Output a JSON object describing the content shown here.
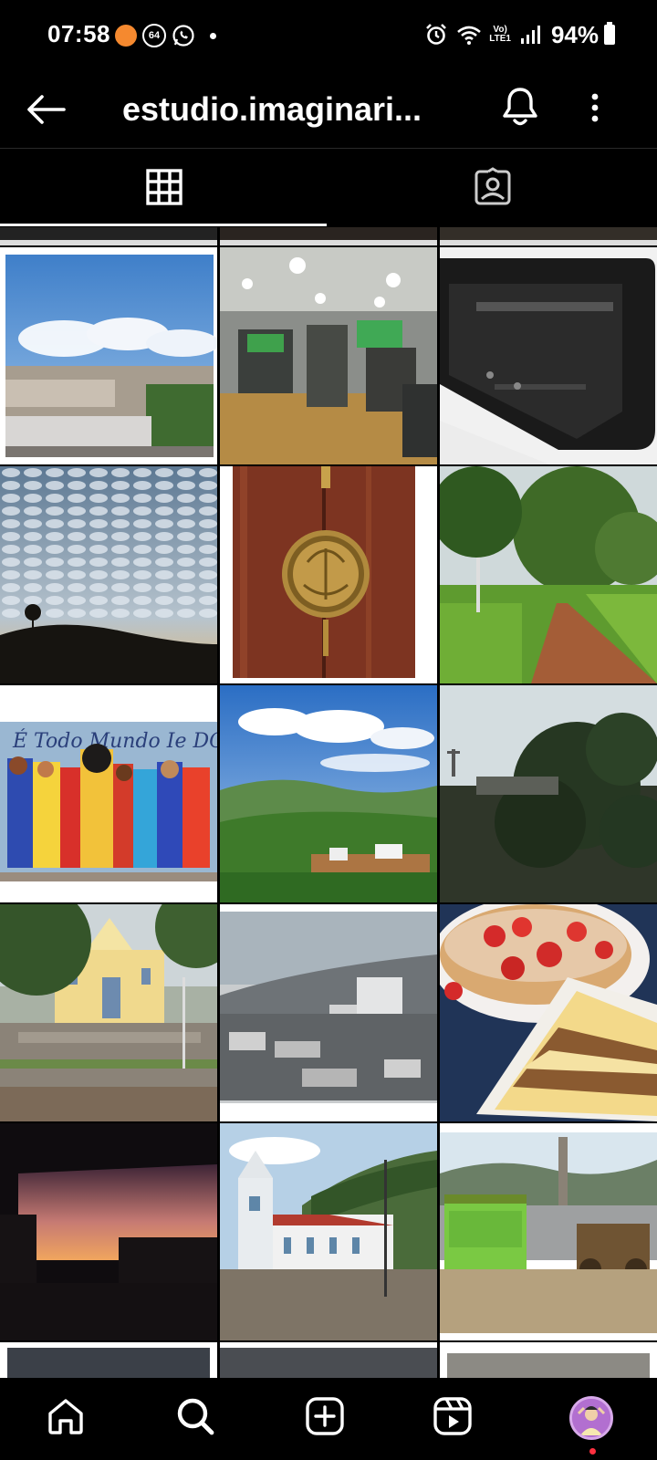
{
  "status_bar": {
    "time": "07:58",
    "notification_badge": "64",
    "network_label_top": "Vo)",
    "network_label_bottom": "LTE1",
    "battery": "94%"
  },
  "header": {
    "profile_name": "estudio.imaginari..."
  },
  "tabs": [
    {
      "icon": "grid-icon",
      "selected": true
    },
    {
      "icon": "tagged-icon",
      "selected": false
    }
  ],
  "grid": {
    "posts": [
      {
        "row": 1,
        "col": 1,
        "subject": "city-sky"
      },
      {
        "row": 1,
        "col": 2,
        "subject": "gym-blur"
      },
      {
        "row": 1,
        "col": 3,
        "subject": "device-closeup"
      },
      {
        "row": 2,
        "col": 1,
        "subject": "clouds-sky"
      },
      {
        "row": 2,
        "col": 2,
        "subject": "wooden-door"
      },
      {
        "row": 2,
        "col": 3,
        "subject": "dirt-road-trees"
      },
      {
        "row": 3,
        "col": 1,
        "subject": "street-mural"
      },
      {
        "row": 3,
        "col": 2,
        "subject": "green-valley"
      },
      {
        "row": 3,
        "col": 3,
        "subject": "tree-statue"
      },
      {
        "row": 4,
        "col": 1,
        "subject": "church-square"
      },
      {
        "row": 4,
        "col": 2,
        "subject": "city-gray"
      },
      {
        "row": 4,
        "col": 3,
        "subject": "strawberry-cake"
      },
      {
        "row": 5,
        "col": 1,
        "subject": "sunset-silhouette"
      },
      {
        "row": 5,
        "col": 2,
        "subject": "white-church"
      },
      {
        "row": 5,
        "col": 3,
        "subject": "green-kiosk"
      }
    ],
    "mural_text": "É Todo Mundo Ie DC"
  },
  "bottom_nav": [
    {
      "icon": "home-icon"
    },
    {
      "icon": "search-icon",
      "selected": true
    },
    {
      "icon": "create-icon"
    },
    {
      "icon": "reels-icon"
    },
    {
      "icon": "profile-avatar"
    }
  ]
}
